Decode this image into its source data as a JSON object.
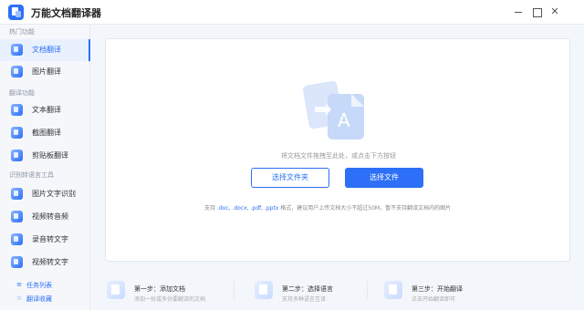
{
  "app": {
    "title": "万能文档翻译器"
  },
  "window": {
    "minimize_icon": "minimize-icon",
    "maximize_icon": "maximize-icon",
    "close_icon": "close-icon",
    "close_glyph": "✕"
  },
  "sidebar": {
    "sections": [
      {
        "title": "热门功能",
        "items": [
          {
            "label": "文档翻译",
            "active": true
          },
          {
            "label": "图片翻译"
          }
        ]
      },
      {
        "title": "翻译功能",
        "items": [
          {
            "label": "文本翻译"
          },
          {
            "label": "截图翻译"
          },
          {
            "label": "剪贴板翻译"
          }
        ]
      },
      {
        "title": "识别转语言工具",
        "items": [
          {
            "label": "图片文字识别"
          },
          {
            "label": "视频转音频"
          },
          {
            "label": "录音转文字"
          },
          {
            "label": "视频转文字"
          }
        ]
      }
    ],
    "bottom_links": [
      {
        "label": "任务列表",
        "icon": "list-icon",
        "glyph": "≡"
      },
      {
        "label": "翻译收藏",
        "icon": "star-icon",
        "glyph": "☆"
      }
    ]
  },
  "main": {
    "drop_hint": "将文档文件拖拽至此处，或点击下方按钮",
    "select_folder_label": "选择文件夹",
    "select_file_label": "选择文件",
    "support_prefix": "支持",
    "support_formats": ".doc, .docx, .pdf, .pptx",
    "support_suffix": "格式，建议用户上传文档大小不超过50M，暂不支持翻译文档内的图片",
    "accent_color": "#2d6ff6"
  },
  "steps": [
    {
      "title": "第一步：添加文档",
      "desc": "添加一份或多份要翻译的文档",
      "icon": "add-document-icon"
    },
    {
      "title": "第二步：选择语言",
      "desc": "支持多种语言互译",
      "icon": "language-icon"
    },
    {
      "title": "第三步：开始翻译",
      "desc": "点击开始翻译即可",
      "icon": "translate-start-icon"
    }
  ]
}
